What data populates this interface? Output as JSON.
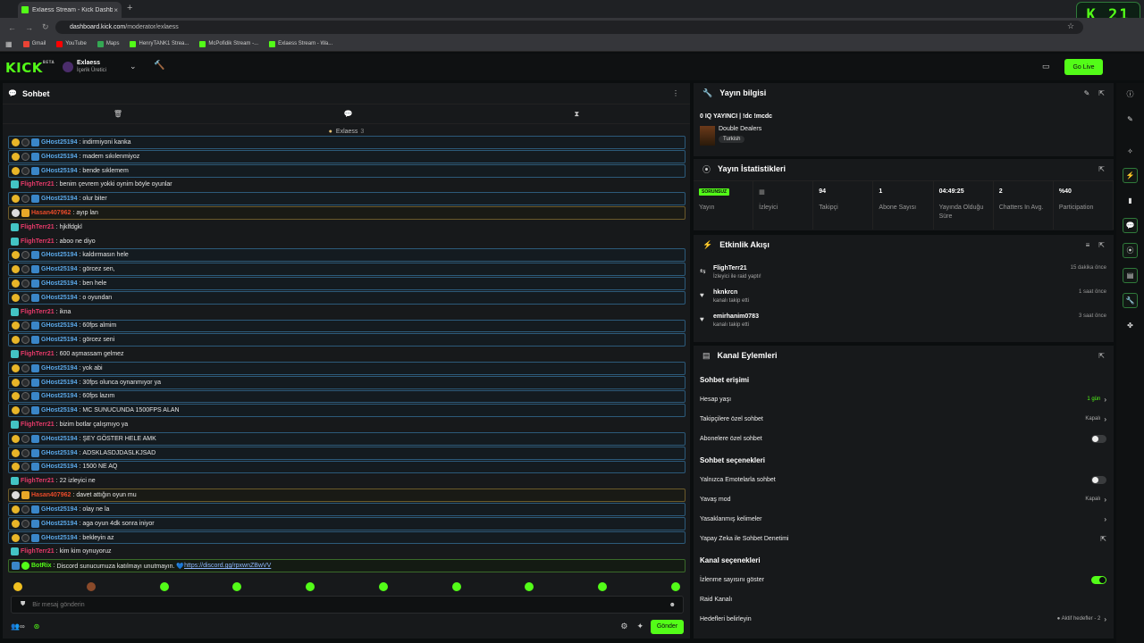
{
  "browser": {
    "tab_title": "Exlaess Stream - Kick Dashboard",
    "tab_close": "×",
    "new_tab": "+",
    "url_host": "dashboard.kick.com",
    "url_path": "/moderator/exlaess",
    "bookmarks": [
      "Gmail",
      "YouTube",
      "Maps",
      "HenryTANK1 Strea...",
      "McPofidik Stream -...",
      "Exlaess Stream - Wa..."
    ],
    "bookmark_colors": [
      "#ea4335",
      "#ff0000",
      "#34a853",
      "#53fc18",
      "#53fc18",
      "#53fc18"
    ],
    "badge": "K 21"
  },
  "topnav": {
    "logo": "KICK",
    "logo_beta": "BETA",
    "channel_name": "Exlaess",
    "channel_role": "İçerik Üretici",
    "go_live": "Go Live"
  },
  "chat": {
    "title": "Sohbet",
    "pinned_user": "Exlaess",
    "pinned_count": "3",
    "input_placeholder": "Bir mesaj gönderin",
    "send_label": "Gönder",
    "messages": [
      {
        "style": "blue",
        "badges": [
          "b-gold",
          "b-dark",
          "b-blue"
        ],
        "user": "GHost25194",
        "ucolor": "u-blue",
        "text": "indirmiyoni kanka"
      },
      {
        "style": "blue",
        "badges": [
          "b-gold",
          "b-dark",
          "b-blue"
        ],
        "user": "GHost25194",
        "ucolor": "u-blue",
        "text": "madem sıkılenmiyoz"
      },
      {
        "style": "blue",
        "badges": [
          "b-gold",
          "b-dark",
          "b-blue"
        ],
        "user": "GHost25194",
        "ucolor": "u-blue",
        "text": "bende sıklemem"
      },
      {
        "style": "plain",
        "badges": [
          "b-teal"
        ],
        "user": "FlighTerr21",
        "ucolor": "u-red",
        "text": "benim çevrem yokki oynim böyle oyunlar"
      },
      {
        "style": "blue",
        "badges": [
          "b-gold",
          "b-dark",
          "b-blue"
        ],
        "user": "GHost25194",
        "ucolor": "u-blue",
        "text": "olur biter"
      },
      {
        "style": "gold",
        "badges": [
          "b-white",
          "b-crown"
        ],
        "user": "Hasan407962",
        "ucolor": "u-orange",
        "text": "ayıp lan"
      },
      {
        "style": "plain",
        "badges": [
          "b-teal"
        ],
        "user": "FlighTerr21",
        "ucolor": "u-red",
        "text": "hjklfdgkl"
      },
      {
        "style": "plain",
        "badges": [
          "b-teal"
        ],
        "user": "FlighTerr21",
        "ucolor": "u-red",
        "text": "aboo ne diyo"
      },
      {
        "style": "blue",
        "badges": [
          "b-gold",
          "b-dark",
          "b-blue"
        ],
        "user": "GHost25194",
        "ucolor": "u-blue",
        "text": "kaldırmasın hele"
      },
      {
        "style": "blue",
        "badges": [
          "b-gold",
          "b-dark",
          "b-blue"
        ],
        "user": "GHost25194",
        "ucolor": "u-blue",
        "text": "görcez sen,"
      },
      {
        "style": "blue",
        "badges": [
          "b-gold",
          "b-dark",
          "b-blue"
        ],
        "user": "GHost25194",
        "ucolor": "u-blue",
        "text": "ben hele"
      },
      {
        "style": "blue",
        "badges": [
          "b-gold",
          "b-dark",
          "b-blue"
        ],
        "user": "GHost25194",
        "ucolor": "u-blue",
        "text": "o oyundan"
      },
      {
        "style": "plain",
        "badges": [
          "b-teal"
        ],
        "user": "FlighTerr21",
        "ucolor": "u-red",
        "text": "ikna"
      },
      {
        "style": "blue",
        "badges": [
          "b-gold",
          "b-dark",
          "b-blue"
        ],
        "user": "GHost25194",
        "ucolor": "u-blue",
        "text": "60fps almim"
      },
      {
        "style": "blue",
        "badges": [
          "b-gold",
          "b-dark",
          "b-blue"
        ],
        "user": "GHost25194",
        "ucolor": "u-blue",
        "text": "görcez seni"
      },
      {
        "style": "plain",
        "badges": [
          "b-teal"
        ],
        "user": "FlighTerr21",
        "ucolor": "u-red",
        "text": "600 aşmassam gelmez"
      },
      {
        "style": "blue",
        "badges": [
          "b-gold",
          "b-dark",
          "b-blue"
        ],
        "user": "GHost25194",
        "ucolor": "u-blue",
        "text": "yok abi"
      },
      {
        "style": "blue",
        "badges": [
          "b-gold",
          "b-dark",
          "b-blue"
        ],
        "user": "GHost25194",
        "ucolor": "u-blue",
        "text": "30fps olunca oynanmıyor ya"
      },
      {
        "style": "blue",
        "badges": [
          "b-gold",
          "b-dark",
          "b-blue"
        ],
        "user": "GHost25194",
        "ucolor": "u-blue",
        "text": "60fps lazım"
      },
      {
        "style": "blue",
        "badges": [
          "b-gold",
          "b-dark",
          "b-blue"
        ],
        "user": "GHost25194",
        "ucolor": "u-blue",
        "text": "MC SUNUCUNDA 1500FPS ALAN"
      },
      {
        "style": "plain",
        "badges": [
          "b-teal"
        ],
        "user": "FlighTerr21",
        "ucolor": "u-red",
        "text": "bizim botlar çalışmıyo ya"
      },
      {
        "style": "blue",
        "badges": [
          "b-gold",
          "b-dark",
          "b-blue"
        ],
        "user": "GHost25194",
        "ucolor": "u-blue",
        "text": "ŞEY GÖSTER HELE AMK"
      },
      {
        "style": "blue",
        "badges": [
          "b-gold",
          "b-dark",
          "b-blue"
        ],
        "user": "GHost25194",
        "ucolor": "u-blue",
        "text": "ADSKLASDJDASLKJSAD"
      },
      {
        "style": "blue",
        "badges": [
          "b-gold",
          "b-dark",
          "b-blue"
        ],
        "user": "GHost25194",
        "ucolor": "u-blue",
        "text": "1500 NE AQ"
      },
      {
        "style": "plain",
        "badges": [
          "b-teal"
        ],
        "user": "FlighTerr21",
        "ucolor": "u-red",
        "text": "22 izleyici ne"
      },
      {
        "style": "gold",
        "badges": [
          "b-white",
          "b-crown"
        ],
        "user": "Hasan407962",
        "ucolor": "u-orange",
        "text": "davet attığın oyun mu"
      },
      {
        "style": "blue",
        "badges": [
          "b-gold",
          "b-dark",
          "b-blue"
        ],
        "user": "GHost25194",
        "ucolor": "u-blue",
        "text": "olay ne la"
      },
      {
        "style": "blue",
        "badges": [
          "b-gold",
          "b-dark",
          "b-blue"
        ],
        "user": "GHost25194",
        "ucolor": "u-blue",
        "text": "aga oyun 4dk sonra iniyor"
      },
      {
        "style": "blue",
        "badges": [
          "b-gold",
          "b-dark",
          "b-blue"
        ],
        "user": "GHost25194",
        "ucolor": "u-blue",
        "text": "bekleyin az"
      },
      {
        "style": "plain",
        "badges": [
          "b-teal"
        ],
        "user": "FlighTerr21",
        "ucolor": "u-red",
        "text": "kim kim oynuyoruz"
      },
      {
        "style": "green",
        "badges": [
          "b-blue",
          "b-lime"
        ],
        "user": "BotRix",
        "ucolor": "u-green",
        "text": "Discord sunucumuza katılmayı unutmayın. 💙 ",
        "link": "https://discord.gg/rpxwnZBwVV"
      }
    ],
    "emote_colors": [
      "#f0c020",
      "#8a4a2a",
      "#53fc18",
      "#53fc18",
      "#53fc18",
      "#53fc18",
      "#53fc18",
      "#53fc18",
      "#53fc18",
      "#53fc18"
    ]
  },
  "stream_info": {
    "title": "Yayın bilgisi",
    "stream_title": "0 IQ YAYINCI | !dc !mcdc",
    "category": "Double Dealers",
    "language": "Turkish"
  },
  "stats": {
    "title": "Yayın İstatistikleri",
    "items": [
      {
        "value": "SORUNSUZ",
        "label": "Yayın",
        "tag": true
      },
      {
        "value": "",
        "label": "İzleyici"
      },
      {
        "value": "94",
        "label": "Takipçi"
      },
      {
        "value": "1",
        "label": "Abone Sayısı"
      },
      {
        "value": "04:49:25",
        "label": "Yayında Olduğu Süre"
      },
      {
        "value": "2",
        "label": "Chatters In Avg."
      },
      {
        "value": "%40",
        "label": "Participation"
      }
    ]
  },
  "feed": {
    "title": "Etkinlik Akışı",
    "items": [
      {
        "name": "FlighTerr21",
        "sub": "İzleyici ile raid yaptı!",
        "time": "15 dakika önce",
        "icon": "⇆"
      },
      {
        "name": "hknkrcn",
        "sub": "kanalı takip etti",
        "time": "1 saat önce",
        "icon": "♥"
      },
      {
        "name": "emirhanim0783",
        "sub": "kanalı takip etti",
        "time": "3 saat önce",
        "icon": "♥"
      }
    ]
  },
  "actions": {
    "title": "Kanal Eylemleri",
    "sections": [
      {
        "heading": "Sohbet erişimi",
        "rows": [
          {
            "label": "Hesap yaşı",
            "value": "1 gün",
            "green": true,
            "kind": "chev"
          },
          {
            "label": "Takipçilere özel sohbet",
            "value": "Kapalı",
            "kind": "chev"
          },
          {
            "label": "Abonelere özel sohbet",
            "kind": "toggle",
            "on": false
          }
        ]
      },
      {
        "heading": "Sohbet seçenekleri",
        "rows": [
          {
            "label": "Yalnızca Emotelarla sohbet",
            "kind": "toggle",
            "on": false
          },
          {
            "label": "Yavaş mod",
            "value": "Kapalı",
            "kind": "chev"
          },
          {
            "label": "Yasaklanmış kelimeler",
            "kind": "chev"
          },
          {
            "label": "Yapay Zeka ile Sohbet Denetimi",
            "kind": "ext"
          }
        ]
      },
      {
        "heading": "Kanal seçenekleri",
        "rows": [
          {
            "label": "İzlenme sayısını göster",
            "kind": "toggle",
            "on": true
          },
          {
            "label": "Raid Kanalı",
            "kind": "none"
          },
          {
            "label": "Hedefleri belirleyin",
            "value": "● Aktif hedefler - 2",
            "kind": "chev"
          }
        ]
      }
    ]
  },
  "colors": {
    "accent": "#53fc18",
    "panel": "#17191b",
    "background": "#0b0e0f"
  }
}
